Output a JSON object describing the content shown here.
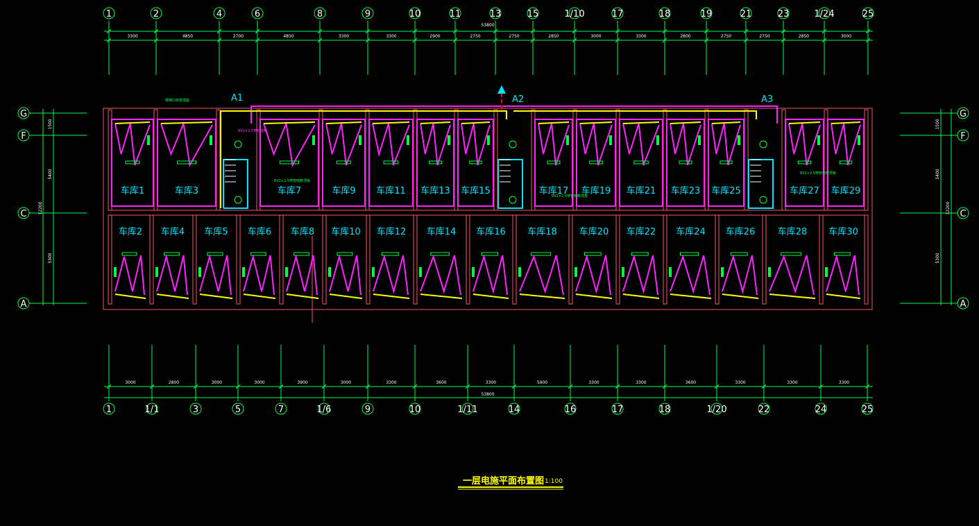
{
  "drawing": {
    "title": "一层电施平面布置图",
    "scale": "1:100",
    "total_top": "53800",
    "total_bottom": "53800",
    "top_axes": [
      "1",
      "2",
      "4",
      "6",
      "8",
      "9",
      "10",
      "11",
      "13",
      "15",
      "1/10",
      "17",
      "18",
      "19",
      "21",
      "23",
      "1/24",
      "25"
    ],
    "top_dims": [
      "3300",
      "4850",
      "2700",
      "4850",
      "3300",
      "3300",
      "2900",
      "2750",
      "2750",
      "2850",
      "3000",
      "3300",
      "2800",
      "2750",
      "2750",
      "2850",
      "3000"
    ],
    "bottom_axes": [
      "1",
      "1/1",
      "3",
      "5",
      "7",
      "1/6",
      "9",
      "10",
      "1/11",
      "14",
      "16",
      "17",
      "18",
      "1/20",
      "22",
      "24",
      "25"
    ],
    "bottom_dims": [
      "3000",
      "2800",
      "3000",
      "3000",
      "3900",
      "3000",
      "3300",
      "3600",
      "3300",
      "5900",
      "3300",
      "3300",
      "3600",
      "3300",
      "3300",
      "3300"
    ],
    "left_axes": [
      "G",
      "F",
      "C",
      "A"
    ],
    "right_axes": [
      "G",
      "F",
      "C",
      "A"
    ],
    "side_dims": [
      "1500",
      "5400",
      "5300"
    ],
    "side_total": "12200",
    "panel_tags": [
      "A1",
      "A2",
      "A3"
    ],
    "upper_rooms": [
      "车库1",
      "车库3",
      "车库7",
      "车库9",
      "车库11",
      "车库13",
      "车库15",
      "车库17",
      "车库19",
      "车库21",
      "车库23",
      "车库25",
      "车库27",
      "车库29"
    ],
    "lower_rooms": [
      "车库2",
      "车库4",
      "车库5",
      "车库6",
      "车库8",
      "车库10",
      "车库12",
      "车库14",
      "车库16",
      "车库18",
      "车库20",
      "车库22",
      "车库24",
      "车库26",
      "车库28",
      "车库30"
    ],
    "notes": {
      "stair_note": "楼梯口安装插座",
      "wire_note_1": "BV2×2.5穿管暗敷",
      "wire_note_2": "BV2×2.5穿管暗敷顶板",
      "wire_note_3": "BV2×2.5穿管暗敷顶板",
      "wire_note_4": "BV2×2.5穿管暗敷顶板"
    }
  }
}
